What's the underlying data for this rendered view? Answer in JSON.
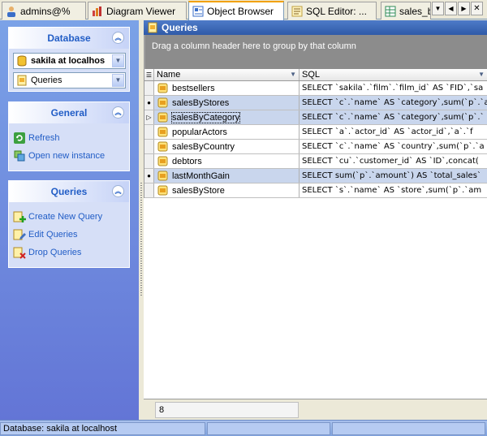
{
  "tabs": [
    {
      "label": "admins@%",
      "icon": "user-icon"
    },
    {
      "label": "Diagram Viewer",
      "icon": "chart-icon"
    },
    {
      "label": "Object Browser",
      "icon": "object-browser-icon"
    },
    {
      "label": "SQL Editor: ...",
      "icon": "sql-editor-icon"
    },
    {
      "label": "sales_b",
      "icon": "table-icon"
    }
  ],
  "active_tab": "Object Browser",
  "database_group": {
    "title": "Database",
    "db_combo": "sakila at localhos",
    "type_combo": "Queries"
  },
  "general_group": {
    "title": "General",
    "links": [
      "Refresh",
      "Open new instance"
    ]
  },
  "queries_group": {
    "title": "Queries",
    "links": [
      "Create New Query",
      "Edit Queries",
      "Drop Queries"
    ]
  },
  "panel_title": "Queries",
  "group_hint": "Drag a column header here to group by that column",
  "columns": [
    "Name",
    "SQL"
  ],
  "rows": [
    {
      "name": "bestsellers",
      "sql": "SELECT  `sakila`.`film`.`film_id` AS `FID`,`sa"
    },
    {
      "name": "salesByStores",
      "sql": "SELECT `c`.`name` AS `category`,sum(`p`.`a"
    },
    {
      "name": "salesByCategory",
      "sql": "SELECT `c`.`name` AS `category`,sum(`p`.`"
    },
    {
      "name": "popularActors",
      "sql": "SELECT `a`.`actor_id` AS `actor_id`,`a`.`f"
    },
    {
      "name": "salesByCountry",
      "sql": "SELECT `c`.`name` AS `country`,sum(`p`.`a"
    },
    {
      "name": "debtors",
      "sql": "SELECT  `cu`.`customer_id` AS `ID`,concat("
    },
    {
      "name": "lastMonthGain",
      "sql": "SELECT sum(`p`.`amount`) AS `total_sales`"
    },
    {
      "name": "salesByStore",
      "sql": "SELECT `s`.`name` AS `store`,sum(`p`.`am"
    }
  ],
  "row_count": "8",
  "status": {
    "text": "Database: sakila at localhost"
  }
}
